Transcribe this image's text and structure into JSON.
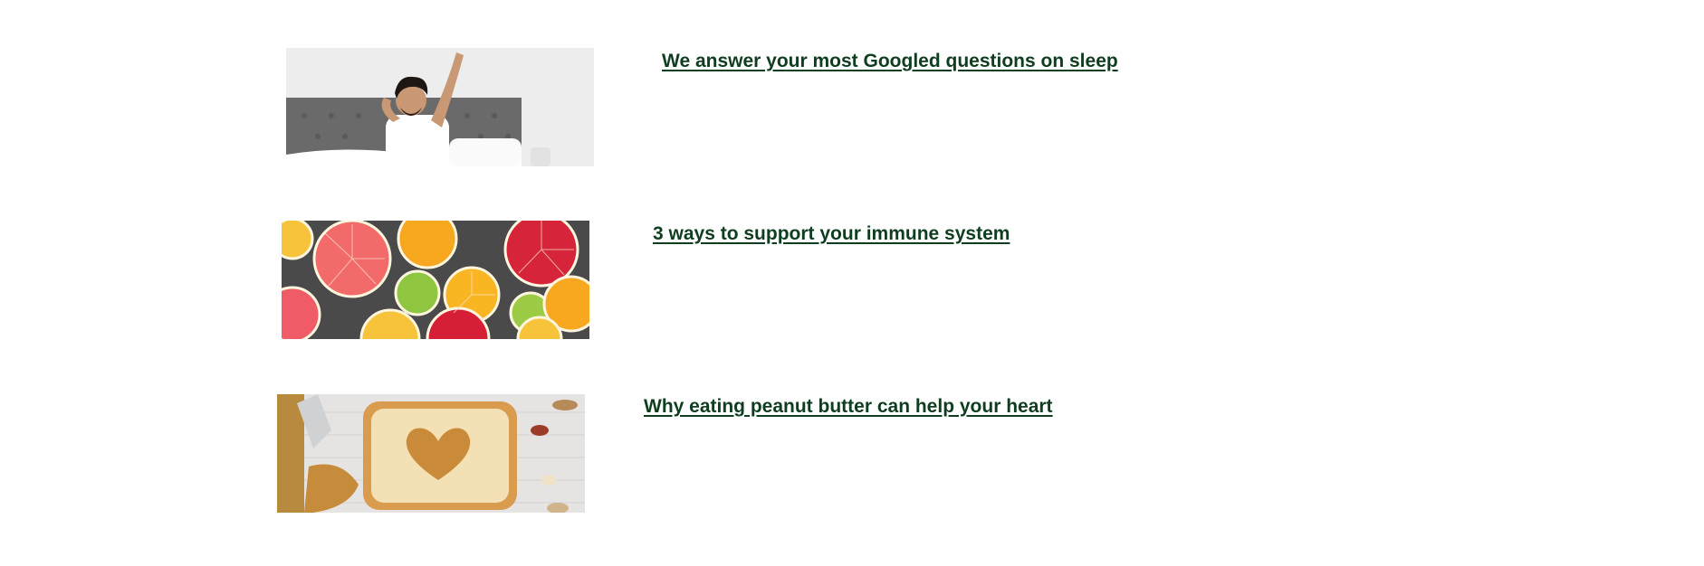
{
  "theme": {
    "link_color": "#0f3d1f"
  },
  "articles": [
    {
      "title": "We answer your most Googled questions on sleep",
      "image_alt": "man-stretching-in-bed-image"
    },
    {
      "title": "3 ways to support your immune system",
      "image_alt": "citrus-fruit-halves-image"
    },
    {
      "title": "Why eating peanut butter can help your heart",
      "image_alt": "peanut-butter-heart-toast-image"
    }
  ]
}
